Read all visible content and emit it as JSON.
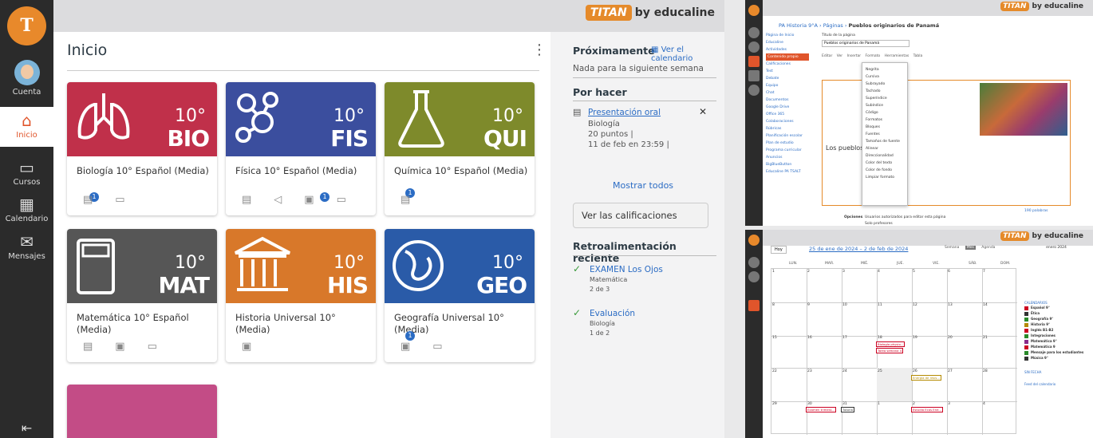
{
  "brand": {
    "logo_text": "TITAN",
    "by": "by educaline"
  },
  "nav": {
    "logo": "T",
    "account": "Cuenta",
    "home": "Inicio",
    "courses": "Cursos",
    "calendar": "Calendario",
    "messages": "Mensajes"
  },
  "main": {
    "title": "Inicio",
    "cards": [
      {
        "grade": "10°",
        "code": "BIO",
        "title": "Biología 10° Español (Media)",
        "color": "#c0304a"
      },
      {
        "grade": "10°",
        "code": "FIS",
        "title": "Física 10° Español (Media)",
        "color": "#3b4e9e"
      },
      {
        "grade": "10°",
        "code": "QUI",
        "title": "Química 10° Español (Media)",
        "color": "#7e8a2b"
      },
      {
        "grade": "10°",
        "code": "MAT",
        "title": "Matemática 10° Español (Media)",
        "color": "#565656"
      },
      {
        "grade": "10°",
        "code": "HIS",
        "title": "Historia Universal 10° (Media)",
        "color": "#d8782a"
      },
      {
        "grade": "10°",
        "code": "GEO",
        "title": "Geografía Universal 10° (Media)",
        "color": "#2a5ba8"
      }
    ],
    "badges": [
      "1",
      "1",
      "1",
      "1"
    ]
  },
  "right": {
    "upcoming_title": "Próximamente",
    "calendar_link": "Ver el calendario",
    "nothing": "Nada para la siguiente semana",
    "todo_title": "Por hacer",
    "todo_item": "Presentación oral",
    "todo_course": "Biología",
    "todo_points": "20 puntos  |",
    "todo_date": "11 de feb en 23:59  |",
    "show_all": "Mostrar todos",
    "grades_btn": "Ver las calificaciones",
    "feedback_title": "Retroalimentación reciente",
    "fb1_title": "EXAMEN Los Ojos",
    "fb1_course": "Matemática",
    "fb1_score": "2 de 3",
    "fb2_title": "Evaluación",
    "fb2_course": "Biología",
    "fb2_score": "1 de 2"
  },
  "panel_top": {
    "breadcrumb_course": "PA Historia 9°A",
    "breadcrumb_pages": "Páginas",
    "breadcrumb_page": "Pueblos originarios de Panamá",
    "sidebar": [
      "Página de Inicio",
      "Educaline",
      "Actividades",
      "Contenido propio",
      "Calificaciones",
      "Test",
      "Debate",
      "Equipo",
      "Chat",
      "Documentos",
      "Google Drive",
      "Office 365",
      "Colaboraciones",
      "Rúbricas",
      "Planificación escolar",
      "Plan de estudio",
      "Programa curricular",
      "Anuncios",
      "BigBlueButton",
      "Educaline PA TSALT"
    ],
    "page_title_label": "Título de la página",
    "page_title_value": "Pueblos originarios de Panamá",
    "menu": [
      "Editar",
      "Ver",
      "Insertar",
      "Formato",
      "Herramientas",
      "Tabla"
    ],
    "dropdown": [
      "Negrita",
      "Cursiva",
      "Subrayado",
      "Tachado",
      "Superíndice",
      "Subíndice",
      "Código",
      "Formatos",
      "Bloques",
      "Fuentes",
      "Tamaños de fuente",
      "Alinear",
      "Direccionalidad",
      "Color del texto",
      "Color de fondo",
      "Limpiar formato"
    ],
    "heading": "Los pueblos in",
    "options_label": "Opciones",
    "options_text": "Usuarios autorizados para editar esta página",
    "options_select": "Solo profesores",
    "word_count": "190 palabras"
  },
  "panel_bottom": {
    "today_btn": "Hoy",
    "range": "25 de ene de 2024 – 2 de feb de 2024",
    "views": [
      "Semana",
      "Mes",
      "Agenda"
    ],
    "days": [
      "LUN.",
      "MAR.",
      "MIÉ.",
      "JUE.",
      "VIE.",
      "SÁB.",
      "DOM."
    ],
    "weeks": [
      [
        "1",
        "2",
        "3",
        "4",
        "5",
        "6",
        "7"
      ],
      [
        "8",
        "9",
        "10",
        "11",
        "12",
        "13",
        "14"
      ],
      [
        "15",
        "16",
        "17",
        "18",
        "19",
        "20",
        "21"
      ],
      [
        "22",
        "23",
        "24",
        "25",
        "26",
        "27",
        "28"
      ],
      [
        "29",
        "30",
        "31",
        "1",
        "2",
        "3",
        "4"
      ]
    ],
    "events": [
      "Biología physio...",
      "Tarea semana 4",
      "Energía de resis...",
      "Examen trimest...",
      "Tutoría",
      "Estudia Ecos Ene..."
    ],
    "mini_month": "enero 2024",
    "calendars_title": "CALENDARIOS",
    "calendars": [
      "Español 9°",
      "Ética",
      "Geografía 9°",
      "Historia 9°",
      "Inglés B1-B2",
      "Integraciones",
      "Matemática 9°",
      "Matemática 9",
      "Mensaje para los estudiantes",
      "Música 9°"
    ],
    "no_date": "SIN FECHA",
    "feed": "Feed del calendario"
  }
}
